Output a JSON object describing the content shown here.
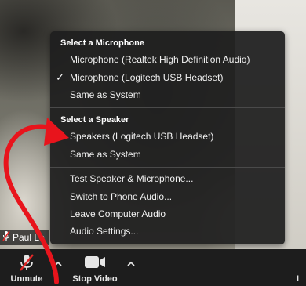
{
  "audio_menu": {
    "microphone_header": "Select a Microphone",
    "microphones": [
      {
        "label": "Microphone (Realtek High Definition Audio)",
        "selected": false
      },
      {
        "label": "Microphone (Logitech USB Headset)",
        "selected": true
      },
      {
        "label": "Same as System",
        "selected": false
      }
    ],
    "speaker_header": "Select a Speaker",
    "speakers": [
      {
        "label": "Speakers (Logitech USB Headset)",
        "selected": true
      },
      {
        "label": "Same as System",
        "selected": false
      }
    ],
    "check_glyph": "✓",
    "actions": [
      "Test Speaker & Microphone...",
      "Switch to Phone Audio...",
      "Leave Computer Audio",
      "Audio Settings..."
    ]
  },
  "participant": {
    "name": "Paul Le",
    "mic_status_icon": "mic-muted-icon"
  },
  "toolbar": {
    "unmute_label": "Unmute",
    "unmute_icon": "mic-muted-icon",
    "stop_video_label": "Stop Video",
    "stop_video_icon": "video-camera-icon",
    "caret_icon": "chevron-up-icon",
    "right_edge_label": "I"
  },
  "colors": {
    "menu_bg": "#1e1e1e",
    "toolbar_bg": "#1d1d1d",
    "mute_slash": "#e02828",
    "annotation_red": "#e8141c"
  }
}
